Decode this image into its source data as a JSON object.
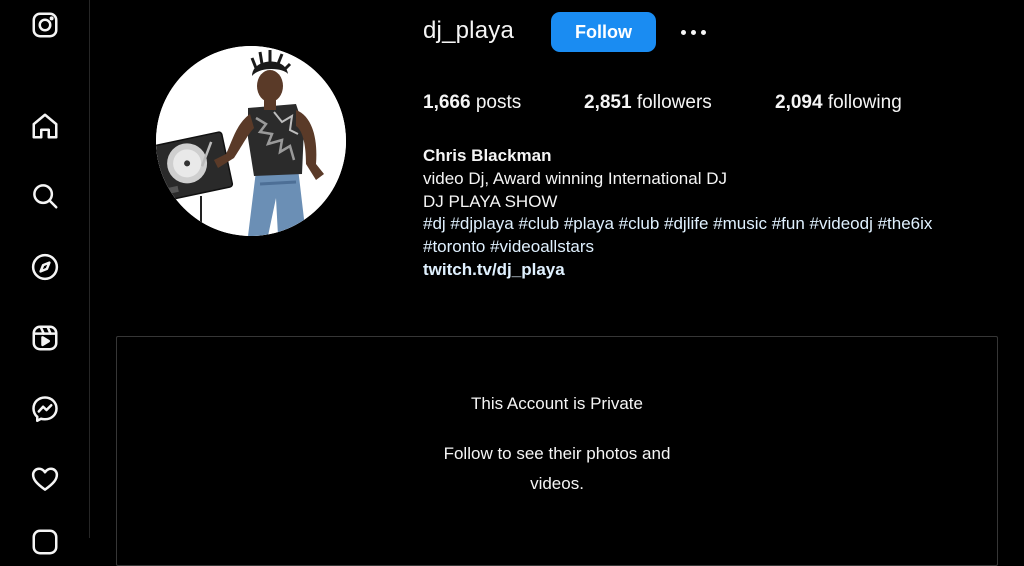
{
  "sidebar": {
    "items": [
      {
        "name": "instagram-logo-icon"
      },
      {
        "name": "home-icon"
      },
      {
        "name": "search-icon"
      },
      {
        "name": "explore-icon"
      },
      {
        "name": "reels-icon"
      },
      {
        "name": "messenger-icon"
      },
      {
        "name": "notifications-heart-icon"
      },
      {
        "name": "create-icon"
      }
    ]
  },
  "profile": {
    "username": "dj_playa",
    "follow_label": "Follow",
    "stats": {
      "posts_count": "1,666",
      "posts_label": "posts",
      "followers_count": "2,851",
      "followers_label": "followers",
      "following_count": "2,094",
      "following_label": "following"
    },
    "bio": {
      "name": "Chris Blackman",
      "line1": "video Dj, Award winning International DJ",
      "line2": "DJ PLAYA SHOW",
      "hashtags1": "#dj #djplaya #club #playa #club #djlife #music #fun #videodj #the6ix",
      "hashtags2": "#toronto #videoallstars",
      "link": "twitch.tv/dj_playa"
    }
  },
  "private_notice": {
    "title": "This Account is Private",
    "subtitle": "Follow to see their photos and videos."
  },
  "colors": {
    "background": "#000000",
    "follow_button": "#1a8cf2",
    "text": "#f5f5f5"
  }
}
